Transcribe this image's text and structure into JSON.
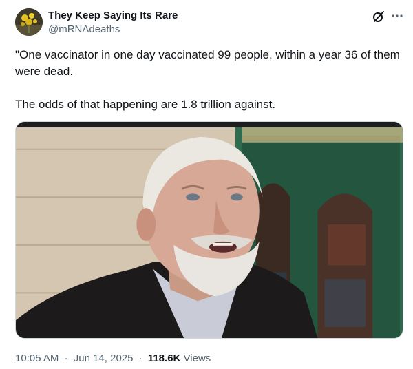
{
  "author": {
    "display_name": "They Keep Saying Its Rare",
    "handle": "@mRNAdeaths",
    "avatar_icon": "avatar-image"
  },
  "header_icons": {
    "grok": "grok-icon",
    "more": "more-icon"
  },
  "tweet": {
    "paragraphs": [
      "\"One vaccinator in one day vaccinated 99 people, within a year 36 of them were dead.",
      "The odds of that happening are 1.8 trillion against."
    ]
  },
  "media": {
    "kind": "video-thumbnail"
  },
  "meta": {
    "time": "10:05 AM",
    "date": "Jun 14, 2025",
    "views_count": "118.6K",
    "views_label": "Views",
    "separator": "·"
  },
  "colors": {
    "primary_text": "#0f1419",
    "secondary_text": "#536471",
    "border": "#cfd9de"
  }
}
